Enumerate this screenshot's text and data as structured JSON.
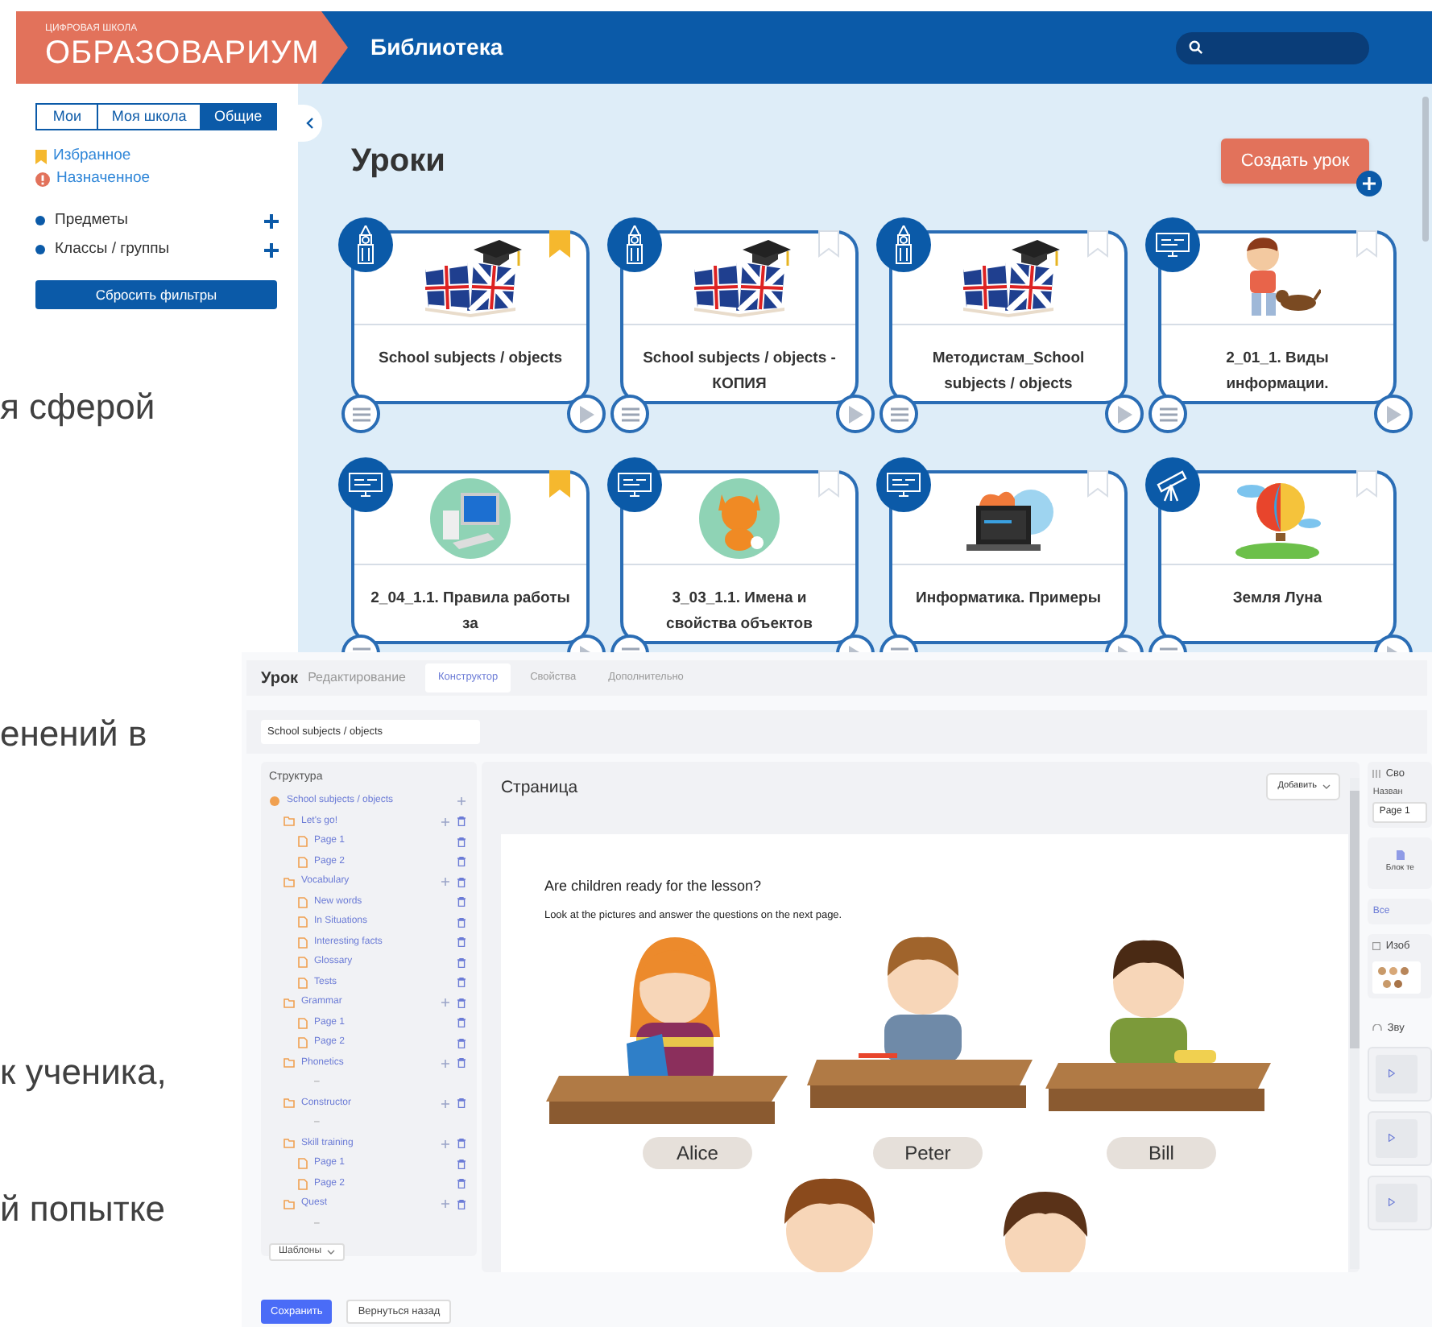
{
  "document_text": [
    "я сферой",
    "енений в",
    "к ученика,",
    "й попытке"
  ],
  "library": {
    "logo": {
      "caption": "ЦИФРОВАЯ ШКОЛА",
      "name": "ОБРАЗОВАРИУМ"
    },
    "header_title": "Библиотека",
    "scope_tabs": [
      {
        "label": "Мои",
        "selected": false
      },
      {
        "label": "Моя школа",
        "selected": false
      },
      {
        "label": "Общие",
        "selected": true
      }
    ],
    "quick_links": [
      {
        "label": "Избранное",
        "kind": "bookmark"
      },
      {
        "label": "Назначенное",
        "kind": "assigned"
      }
    ],
    "filters": [
      {
        "label": "Предметы"
      },
      {
        "label": "Классы / группы"
      }
    ],
    "reset_button": "Сбросить фильтры",
    "title": "Уроки",
    "create_button": "Создать урок",
    "lessons": [
      {
        "title": "School subjects / objects",
        "kind": "english",
        "bookmarked": true
      },
      {
        "title": "School subjects / objects - КОПИЯ",
        "kind": "english",
        "bookmarked": false
      },
      {
        "title": "Методистам_School subjects / objects",
        "kind": "english",
        "bookmarked": false
      },
      {
        "title": "2_01_1. Виды информации.",
        "kind": "informatics",
        "bookmarked": false
      },
      {
        "title": "2_04_1.1. Правила работы за",
        "kind": "informatics",
        "bookmarked": true
      },
      {
        "title": "3_03_1.1. Имена и свойства объектов",
        "kind": "informatics",
        "bookmarked": false
      },
      {
        "title": "Информатика. Примеры",
        "kind": "informatics",
        "bookmarked": false
      },
      {
        "title": "Земля Луна",
        "kind": "astronomy",
        "bookmarked": false
      }
    ]
  },
  "editor": {
    "breadcrumb": {
      "title": "Урок",
      "subtitle": "Редактирование"
    },
    "tabs": [
      {
        "label": "Конструктор",
        "selected": true
      },
      {
        "label": "Свойства",
        "selected": false
      },
      {
        "label": "Дополнительно",
        "selected": false
      }
    ],
    "lesson_name": "School subjects / objects",
    "structure": {
      "title": "Структура",
      "templates_button": "Шаблоны",
      "root": {
        "label": "School subjects / objects",
        "kind": "lesson",
        "children": [
          {
            "label": "Let's go!",
            "kind": "folder",
            "children": [
              {
                "label": "Page 1",
                "kind": "page"
              },
              {
                "label": "Page 2",
                "kind": "page"
              }
            ]
          },
          {
            "label": "Vocabulary",
            "kind": "folder",
            "children": [
              {
                "label": "New words",
                "kind": "page"
              },
              {
                "label": "In Situations",
                "kind": "page"
              },
              {
                "label": "Interesting facts",
                "kind": "page"
              },
              {
                "label": "Glossary",
                "kind": "page"
              },
              {
                "label": "Tests",
                "kind": "page"
              }
            ]
          },
          {
            "label": "Grammar",
            "kind": "folder",
            "children": [
              {
                "label": "Page 1",
                "kind": "page"
              },
              {
                "label": "Page 2",
                "kind": "page"
              }
            ]
          },
          {
            "label": "Phonetics",
            "kind": "folder",
            "children": [
              {
                "label": "–",
                "kind": "empty"
              }
            ]
          },
          {
            "label": "Constructor",
            "kind": "folder",
            "children": [
              {
                "label": "–",
                "kind": "empty"
              }
            ]
          },
          {
            "label": "Skill training",
            "kind": "folder",
            "children": [
              {
                "label": "Page 1",
                "kind": "page"
              },
              {
                "label": "Page 2",
                "kind": "page"
              }
            ]
          },
          {
            "label": "Quest",
            "kind": "folder",
            "children": [
              {
                "label": "–",
                "kind": "empty"
              }
            ]
          }
        ]
      }
    },
    "page": {
      "title": "Страница",
      "add_button": "Добавить",
      "heading": "Are children ready for the lesson?",
      "instruction": "Look at the pictures and answer the questions on the next page.",
      "names": [
        "Alice",
        "Peter",
        "Bill"
      ]
    },
    "side_panel": {
      "properties_title": "Сво",
      "name_label": "Назван",
      "name_value": "Page 1",
      "text_block": "Блок те",
      "filter": "Все",
      "images_title": "Изоб",
      "sounds_title": "Зву",
      "sounds": [
        {
          "kind": "audio"
        },
        {
          "kind": "audio"
        },
        {
          "kind": "audio"
        }
      ]
    },
    "buttons": [
      {
        "label": "Сохранить",
        "kind": "primary"
      },
      {
        "label": "Вернуться назад",
        "kind": "secondary"
      }
    ]
  }
}
